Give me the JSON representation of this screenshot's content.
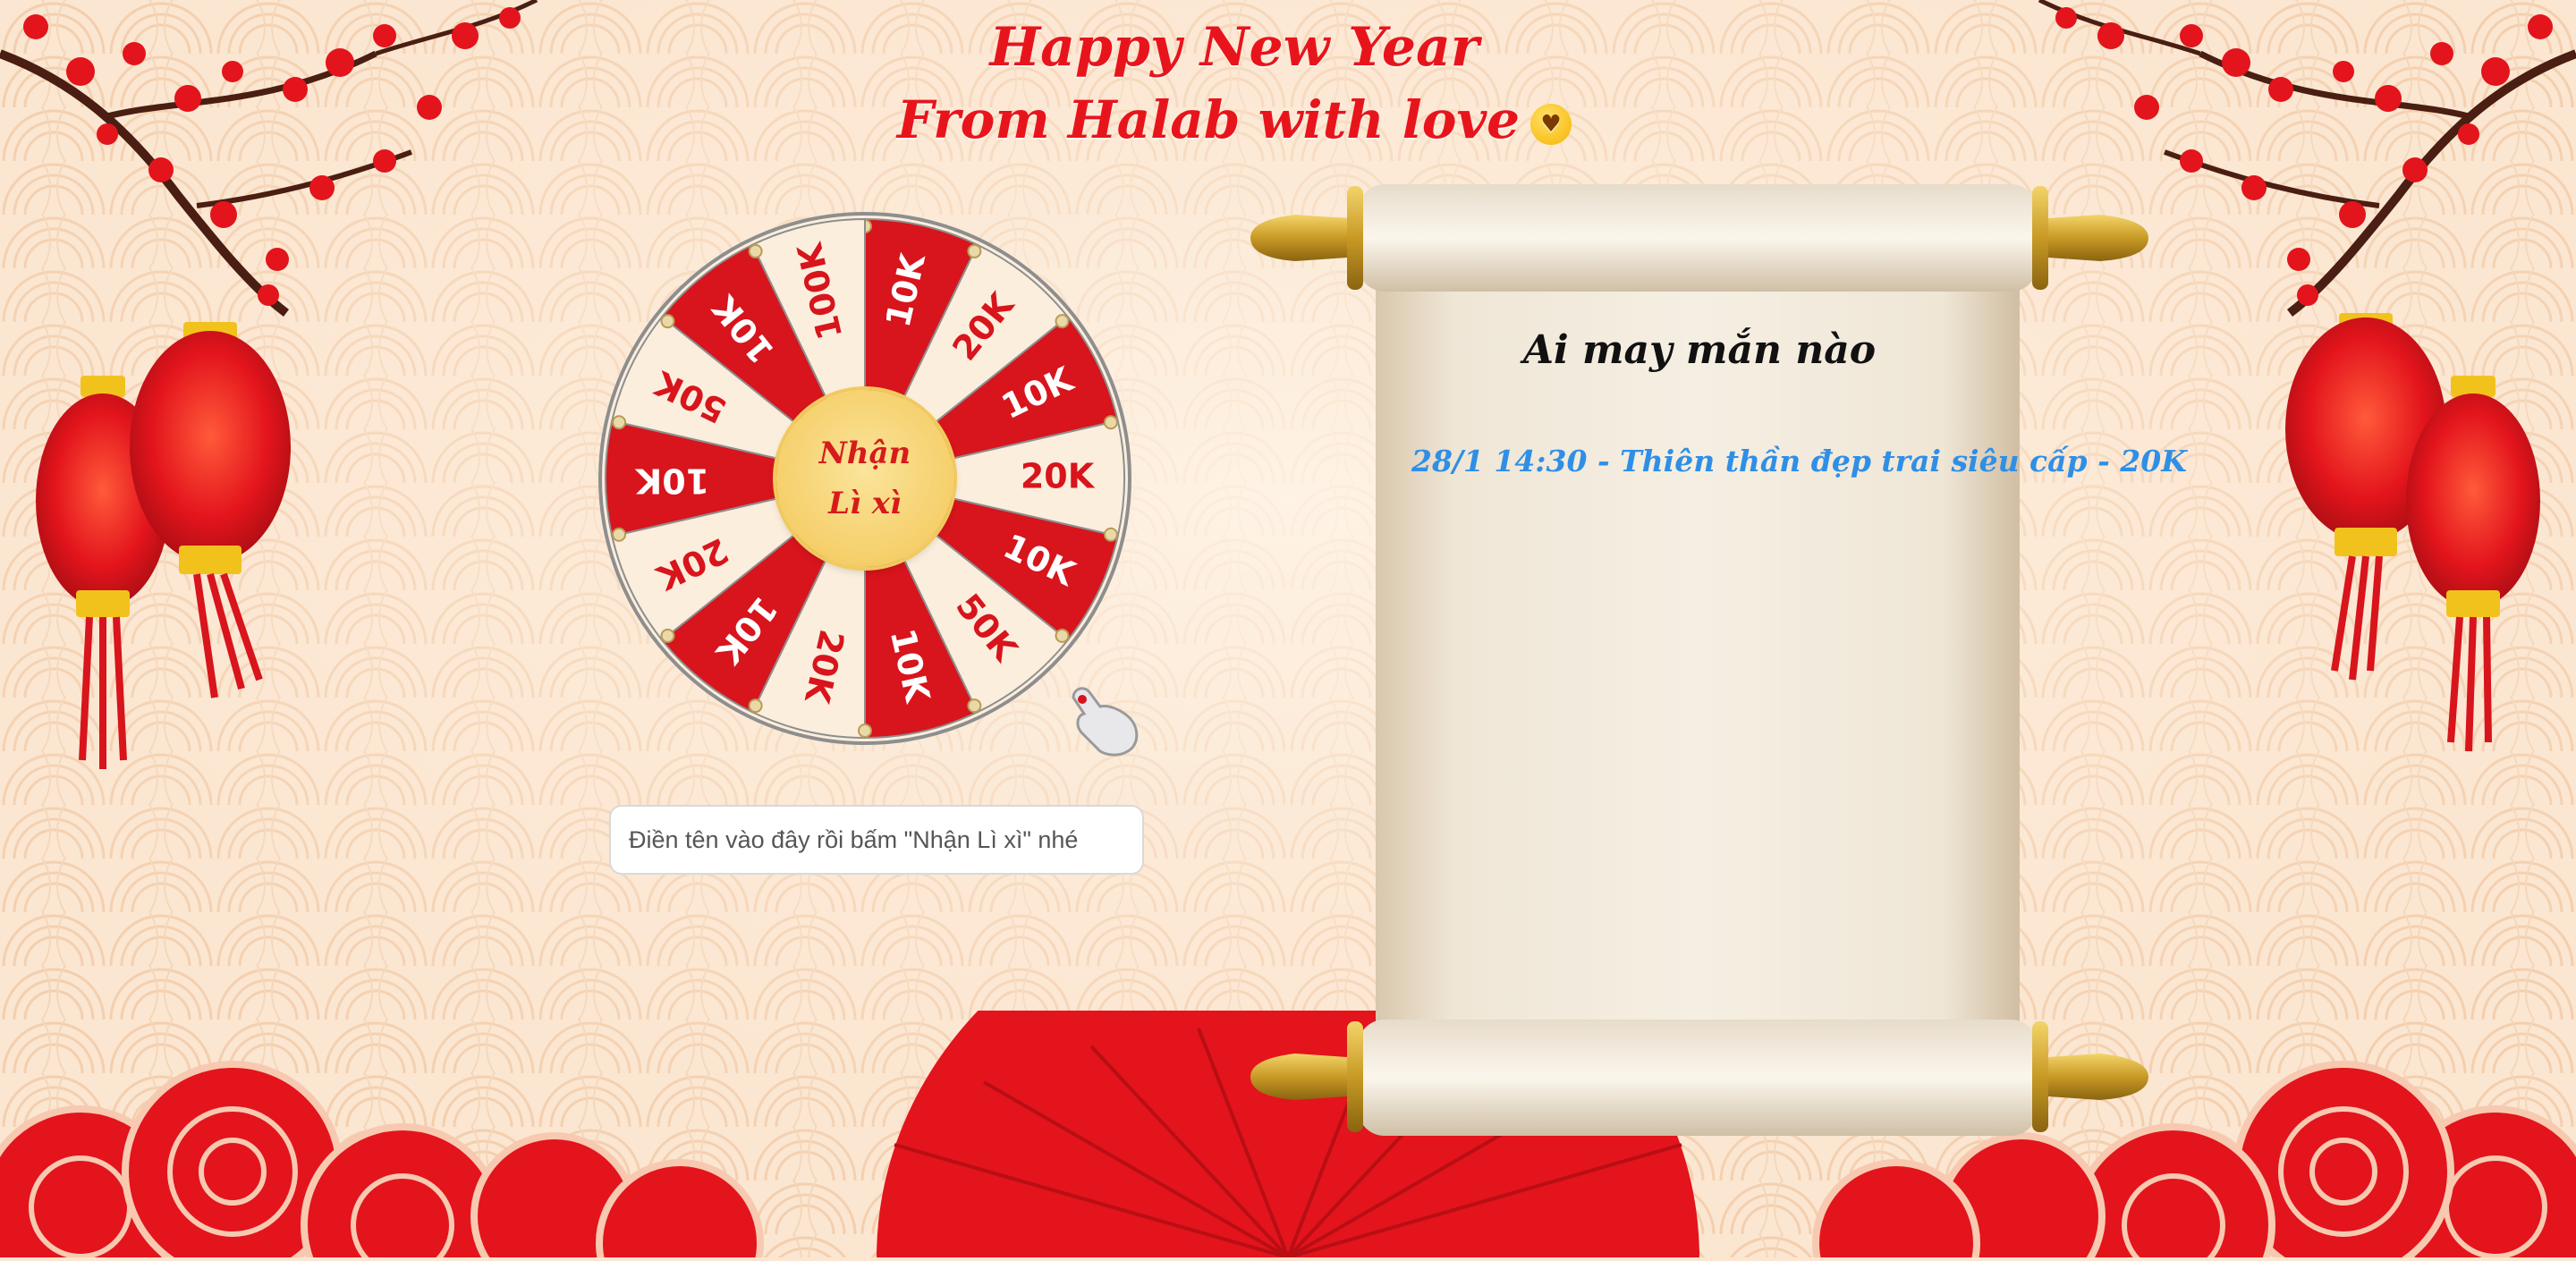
{
  "header": {
    "line1": "Happy New Year",
    "line2": "From Halab with love",
    "emoji": "😘"
  },
  "wheel": {
    "segments": [
      "10K",
      "20K",
      "10K",
      "20K",
      "10K",
      "50K",
      "10K",
      "20K",
      "10K",
      "20K",
      "10K",
      "50K",
      "10K",
      "100K"
    ],
    "center_line1": "Nhận",
    "center_line2": "Lì xì",
    "colors": {
      "red": "#d8141c",
      "cream": "#fbeedd",
      "rim": "#c99a4b",
      "hub": "#f5cf6a"
    }
  },
  "name_input": {
    "placeholder": "Điền tên vào đây rồi bấm \"Nhận Lì xì\" nhé",
    "value": ""
  },
  "winners": {
    "title": "Ai may mắn nào",
    "entries": [
      "28/1 14:30 - Thiên thần đẹp trai siêu cấp - 20K"
    ]
  },
  "icons": {
    "pointer": "hand-pointer-icon",
    "lantern": "lantern-icon",
    "blossom": "plum-blossom-icon"
  }
}
